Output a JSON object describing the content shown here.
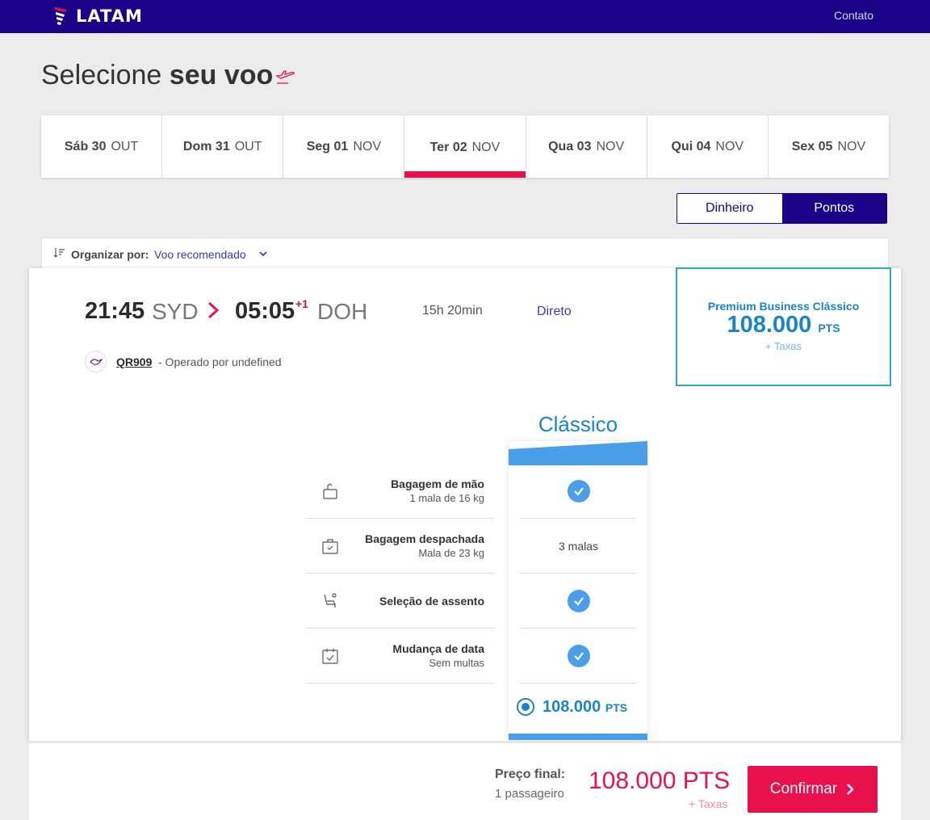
{
  "header": {
    "logo_text": "LATAM",
    "contact_link": "Contato",
    "bg_color": "#1b0088"
  },
  "page": {
    "title_light": "Selecione ",
    "title_bold": "seu voo"
  },
  "date_tabs": [
    {
      "day": "Sáb 30",
      "month": "OUT",
      "active": false
    },
    {
      "day": "Dom 31",
      "month": "OUT",
      "active": false
    },
    {
      "day": "Seg 01",
      "month": "NOV",
      "active": false
    },
    {
      "day": "Ter 02",
      "month": "NOV",
      "active": true
    },
    {
      "day": "Qua 03",
      "month": "NOV",
      "active": false
    },
    {
      "day": "Qui 04",
      "month": "NOV",
      "active": false
    },
    {
      "day": "Sex 05",
      "month": "NOV",
      "active": false
    }
  ],
  "currency_toggle": {
    "money_label": "Dinheiro",
    "points_label": "Pontos",
    "selected": "Pontos"
  },
  "sort": {
    "label": "Organizar por:",
    "value": "Voo recomendado"
  },
  "flight": {
    "departure_time": "21:45",
    "departure_airport": "SYD",
    "arrival_time": "05:05",
    "plus_days": "+1",
    "arrival_airport": "DOH",
    "duration": "15h 20min",
    "stops": "Direto",
    "flight_number": "QR909",
    "operated_by": "- Operado por undefined",
    "fare": {
      "name": "Premium Business Clássico",
      "price": "108.000",
      "unit": "PTS",
      "taxes": "+ Taxas"
    },
    "class_name": "Clássico",
    "benefits": [
      {
        "name": "Bagagem de mão",
        "sub": "1 mala de 16 kg",
        "value_type": "check",
        "value": ""
      },
      {
        "name": "Bagagem despachada",
        "sub": "Mala de 23 kg",
        "value_type": "text",
        "value": "3 malas"
      },
      {
        "name": "Seleção de assento",
        "sub": "",
        "value_type": "check",
        "value": ""
      },
      {
        "name": "Mudança de data",
        "sub": "Sem multas",
        "value_type": "check",
        "value": ""
      }
    ],
    "class_price": "108.000",
    "class_price_unit": "PTS"
  },
  "footer": {
    "final_label": "Preço final:",
    "passengers": "1 passageiro",
    "final_price": "108.000 PTS",
    "taxes": "+ Taxas",
    "confirm_label": "Confirmar"
  },
  "colors": {
    "brand_navy": "#1b0088",
    "brand_red": "#e8114b",
    "fare_blue": "#1a84c7",
    "fare_border": "#2bb0bb"
  }
}
